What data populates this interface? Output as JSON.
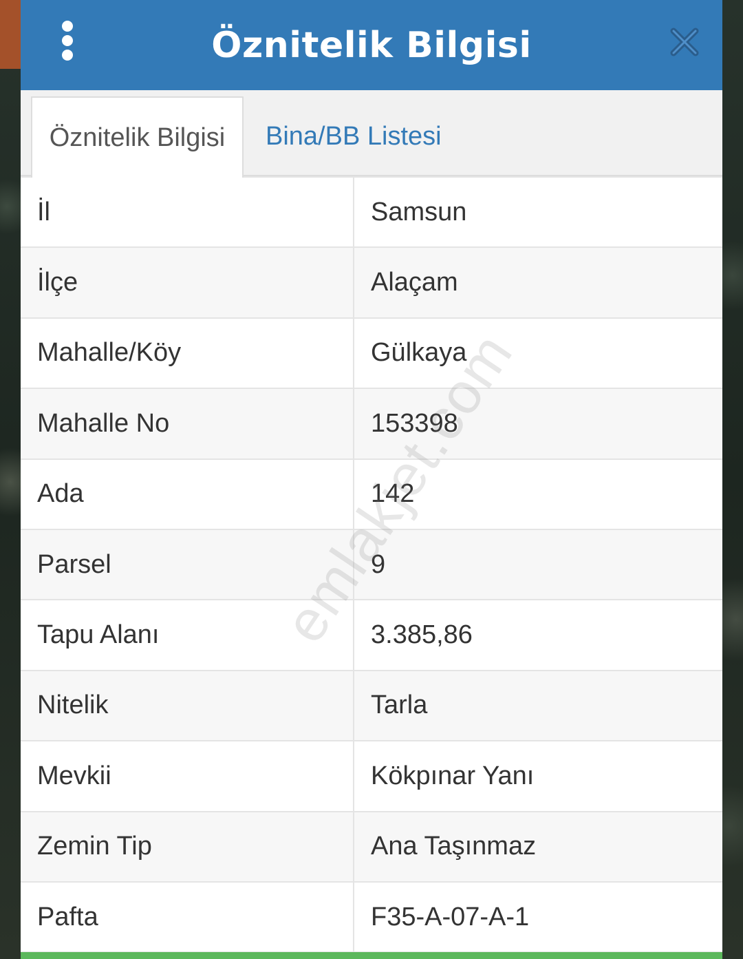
{
  "dialog": {
    "title": "Öznitelik Bilgisi"
  },
  "tabs": [
    {
      "label": "Öznitelik Bilgisi",
      "active": true
    },
    {
      "label": "Bina/BB Listesi",
      "active": false
    }
  ],
  "rows": [
    {
      "key": "İl",
      "value": "Samsun"
    },
    {
      "key": "İlçe",
      "value": "Alaçam"
    },
    {
      "key": "Mahalle/Köy",
      "value": "Gülkaya"
    },
    {
      "key": "Mahalle No",
      "value": "153398"
    },
    {
      "key": "Ada",
      "value": "142"
    },
    {
      "key": "Parsel",
      "value": "9"
    },
    {
      "key": "Tapu Alanı",
      "value": "3.385,86"
    },
    {
      "key": "Nitelik",
      "value": "Tarla"
    },
    {
      "key": "Mevkii",
      "value": "Kökpınar Yanı"
    },
    {
      "key": "Zemin Tip",
      "value": "Ana Taşınmaz"
    },
    {
      "key": "Pafta",
      "value": "F35-A-07-A-1"
    }
  ],
  "watermark": "emlakjet.com",
  "icons": {
    "menu": "more-vertical-icon",
    "close": "close-icon"
  },
  "colors": {
    "header": "#337ab7",
    "tab_link": "#337ab7",
    "footer_bar": "#5cb85c"
  }
}
